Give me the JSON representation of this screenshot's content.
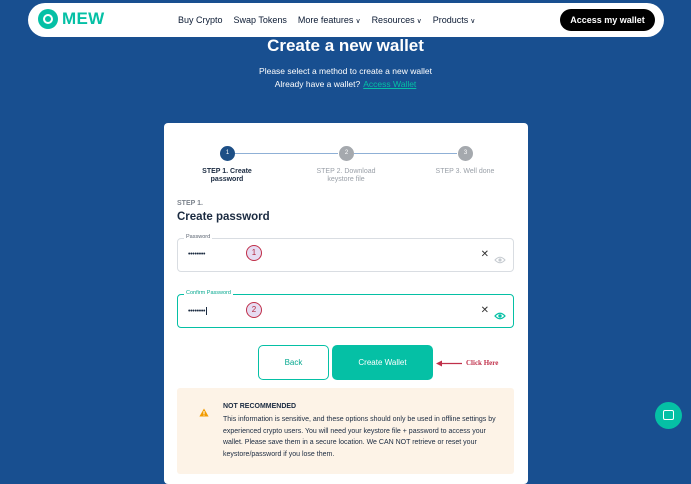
{
  "colors": {
    "accent": "#05c0a5",
    "background": "#184f90",
    "active_step": "#1d4f86",
    "warning": "#f29b00",
    "annotation": "#c0304a"
  },
  "nav": {
    "logo_text": "MEW",
    "links": [
      "Buy Crypto",
      "Swap Tokens",
      "More features",
      "Resources",
      "Products"
    ],
    "access_label": "Access my wallet"
  },
  "header": {
    "title": "Create a new wallet",
    "subtitle": "Please select a method to create a new wallet",
    "already_text": "Already have a wallet?",
    "access_link": "Access Wallet"
  },
  "stepper": {
    "steps": [
      {
        "number": "1",
        "label": "STEP 1. Create password",
        "state": "active"
      },
      {
        "number": "2",
        "label": "STEP 2. Download keystore file",
        "state": "inactive"
      },
      {
        "number": "3",
        "label": "STEP 3. Well done",
        "state": "inactive"
      }
    ]
  },
  "form": {
    "step_small": "STEP 1.",
    "heading": "Create password",
    "password": {
      "label": "Password",
      "value": "••••••••",
      "marker": "1"
    },
    "confirm": {
      "label": "Confirm Password",
      "value": "••••••••",
      "marker": "2"
    },
    "back_label": "Back",
    "create_label": "Create Wallet"
  },
  "warning": {
    "title": "NOT RECOMMENDED",
    "body": "This information is sensitive, and these options should only be used in offline settings by experienced crypto users. You will need your keystore file + password to access your wallet. Please save them in a secure location. We CAN NOT retrieve or reset your keystore/password if you lose them."
  },
  "annotation": {
    "text": "Click Here"
  },
  "icons": [
    "logo-icon",
    "chevron-down-icon",
    "clear-icon",
    "eye-icon",
    "warning-icon",
    "arrow-left-icon",
    "chat-icon"
  ]
}
